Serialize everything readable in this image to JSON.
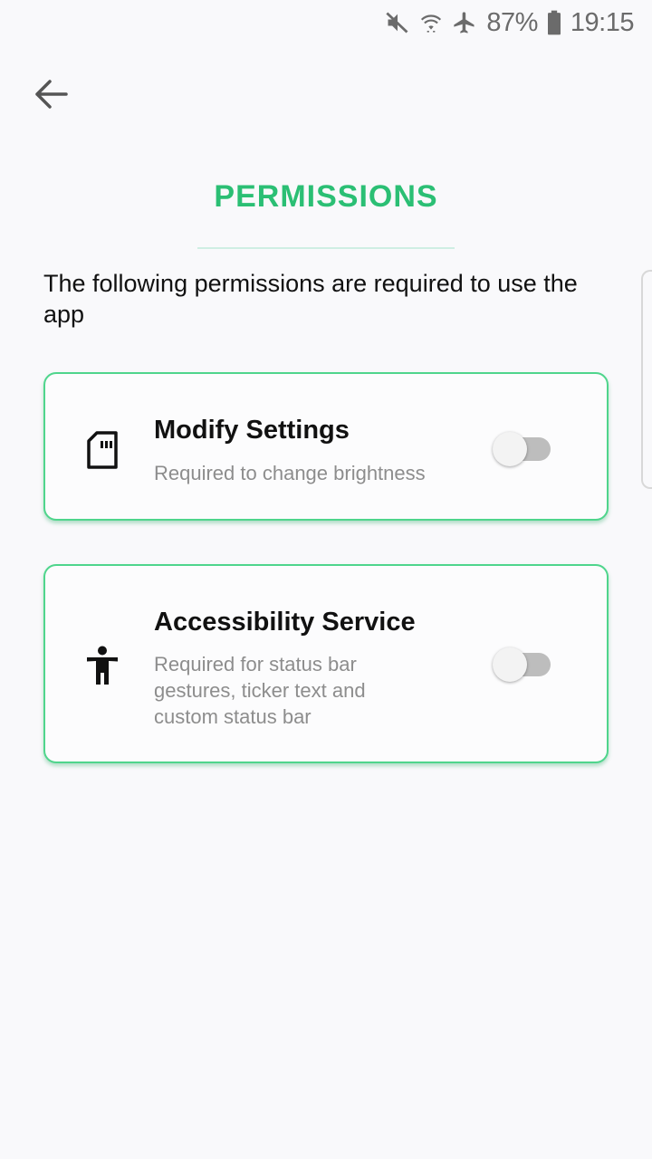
{
  "status_bar": {
    "battery_percent": "87%",
    "time": "19:15",
    "icons": [
      "mute-icon",
      "wifi-icon",
      "airplane-icon",
      "battery-icon"
    ]
  },
  "header": {
    "back_icon": "arrow-left-icon",
    "title": "PERMISSIONS"
  },
  "intro": "The following permissions are required to use the app",
  "permissions": [
    {
      "icon": "sd-card-icon",
      "title": "Modify Settings",
      "description": "Required to change brightness",
      "enabled": false
    },
    {
      "icon": "accessibility-icon",
      "title": "Accessibility Service",
      "description": "Required for status bar gestures, ticker text and custom status bar",
      "enabled": false
    }
  ],
  "colors": {
    "accent": "#2bbf74",
    "card_border": "#4fd58c",
    "background": "#f9f9fb"
  }
}
